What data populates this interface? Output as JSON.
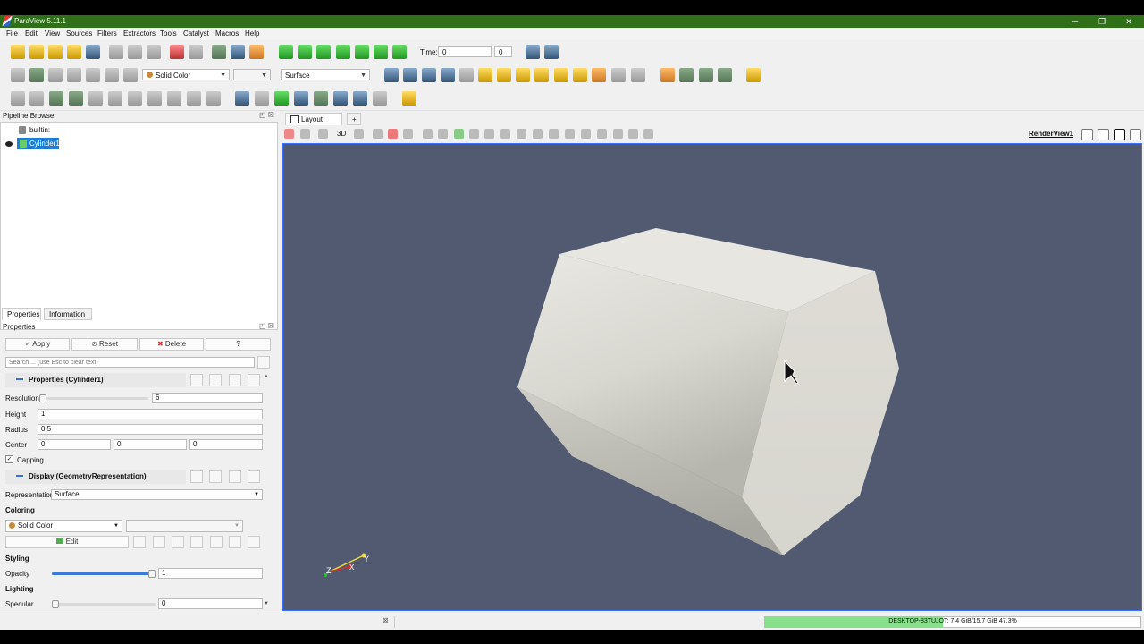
{
  "window": {
    "title": "ParaView 5.11.1"
  },
  "window_controls": {
    "minimize": "─",
    "maximize": "❐",
    "close": "✕"
  },
  "menu": [
    "File",
    "Edit",
    "View",
    "Sources",
    "Filters",
    "Extractors",
    "Tools",
    "Catalyst",
    "Macros",
    "Help"
  ],
  "time": {
    "label": "Time:",
    "value": "0",
    "step": "0"
  },
  "coloring_combo": "Solid Color",
  "representation_combo": "Surface",
  "pipeline_browser": {
    "title": "Pipeline Browser",
    "items": [
      {
        "label": "builtin:"
      },
      {
        "label": "Cylinder1"
      }
    ]
  },
  "tabs": {
    "properties": "Properties",
    "information": "Information"
  },
  "properties_panel": {
    "title": "Properties",
    "apply": "Apply",
    "reset": "Reset",
    "delete": "Delete",
    "help": "?",
    "search_placeholder": "Search ... (use Esc to clear text)",
    "section_properties": "Properties (Cylinder1)",
    "resolution_label": "Resolution",
    "resolution_value": "6",
    "resolution_fraction": 0.0,
    "height_label": "Height",
    "height_value": "1",
    "radius_label": "Radius",
    "radius_value": "0.5",
    "center_label": "Center",
    "center_x": "0",
    "center_y": "0",
    "center_z": "0",
    "capping_label": "Capping",
    "capping_checked": "✓",
    "section_display": "Display (GeometryRepresentation)",
    "representation_label": "Representation",
    "representation_value": "Surface",
    "coloring_heading": "Coloring",
    "coloring_value": "Solid Color",
    "edit_label": "Edit",
    "styling_heading": "Styling",
    "opacity_label": "Opacity",
    "opacity_value": "1",
    "opacity_fraction": 1.0,
    "lighting_heading": "Lighting",
    "specular_label": "Specular",
    "specular_value": "0",
    "specular_fraction": 0.0
  },
  "layout": {
    "tab_label": "Layout #1",
    "add_tab": "+",
    "render_view": "RenderView1",
    "threeD": "3D"
  },
  "axes": {
    "x": "X",
    "y": "Y",
    "z": "Z"
  },
  "status": {
    "memory_text": "DESKTOP-83TUJOT: 7.4 GiB/15.7 GiB 47.3%",
    "memory_fraction": 0.473
  },
  "colors": {
    "titlebar": "#2e6f17",
    "viewport_bg": "#525a72",
    "accent": "#3b7bd8",
    "memory_fill": "#88e08a"
  },
  "icons": [
    "open-icon",
    "save-icon",
    "undo-icon",
    "redo-icon",
    "play-icon",
    "first-frame-icon",
    "last-frame-icon",
    "camera-reset-icon",
    "light-bulb-icon",
    "ruler-icon",
    "calculator-icon",
    "eye-icon"
  ]
}
